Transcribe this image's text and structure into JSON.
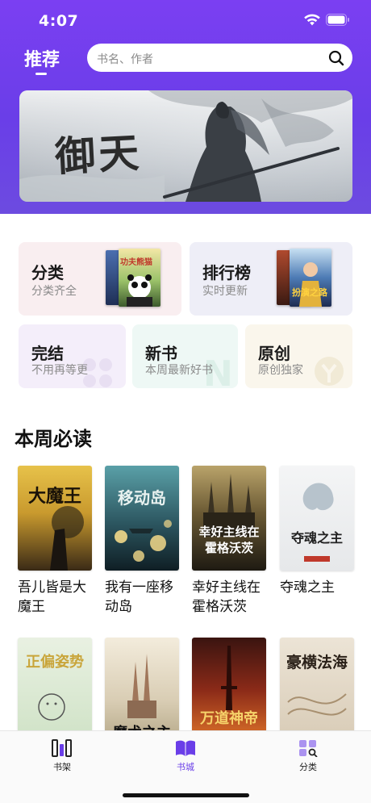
{
  "status_bar": {
    "time": "4:07"
  },
  "header": {
    "title": "推荐"
  },
  "search": {
    "placeholder": "书名、作者"
  },
  "banner": {
    "title": "御天"
  },
  "categories": [
    {
      "title": "分类",
      "subtitle": "分类齐全"
    },
    {
      "title": "排行榜",
      "subtitle": "实时更新"
    },
    {
      "title": "完结",
      "subtitle": "不用再等更"
    },
    {
      "title": "新书",
      "subtitle": "本周最新好书"
    },
    {
      "title": "原创",
      "subtitle": "原创独家"
    }
  ],
  "category_cover_text": {
    "fenlei_book": "功夫熊猫",
    "paihang_book": "扮演之路"
  },
  "section": {
    "title": "本周必读"
  },
  "books": [
    {
      "name": "吾儿皆是大魔王",
      "cover_text": "大魔王"
    },
    {
      "name": "我有一座移动岛",
      "cover_text": "移动岛"
    },
    {
      "name": "幸好主线在霍格沃茨",
      "cover_text": "幸好主线在霍格沃茨"
    },
    {
      "name": "夺魂之主",
      "cover_text": "夺魂之主"
    },
    {
      "name": "",
      "cover_text": "正偏姿势"
    },
    {
      "name": "",
      "cover_text": "魔术之主"
    },
    {
      "name": "",
      "cover_text": "万道神帝"
    },
    {
      "name": "",
      "cover_text": "豪横法海"
    }
  ],
  "tabbar": [
    {
      "label": "书架",
      "icon": "bookshelf-icon"
    },
    {
      "label": "书城",
      "icon": "book-open-icon"
    },
    {
      "label": "分类",
      "icon": "category-grid-icon"
    }
  ],
  "colors": {
    "accent": "#6a3ee8",
    "header_gradient_top": "#7b3ff2"
  }
}
